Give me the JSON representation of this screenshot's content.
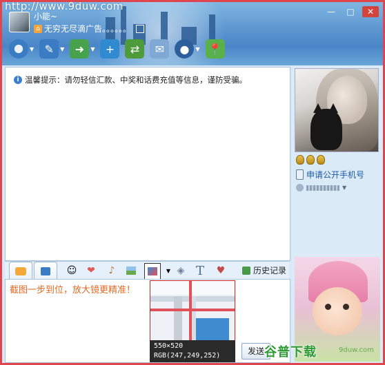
{
  "watermark": "http://www.9duw.com",
  "user": {
    "nickname": "小能~",
    "signature": "无穷无尽滴广告。。。。。。"
  },
  "window_buttons": {
    "minimize": "—",
    "maximize": "□",
    "close": "✕"
  },
  "toolbar": {
    "items": [
      {
        "name": "video-call",
        "icon": "camera-icon",
        "color": "#3a7cc4",
        "has_dropdown": true
      },
      {
        "name": "voice-call",
        "icon": "pen-icon",
        "color": "#3a7cc4",
        "has_dropdown": true
      },
      {
        "name": "file-transfer",
        "icon": "file-send-icon",
        "color": "#47a34b",
        "has_dropdown": true
      },
      {
        "name": "create-group",
        "icon": "group-add-icon",
        "color": "#2f8ad0",
        "has_dropdown": false
      },
      {
        "name": "share-screen",
        "icon": "share-icon",
        "color": "#4d9b3a",
        "has_dropdown": false
      },
      {
        "name": "send-mail",
        "icon": "mail-icon",
        "color": "#7fa8d4",
        "has_dropdown": false
      },
      {
        "name": "apps",
        "icon": "police-hat-icon",
        "color": "#2d5f9c",
        "has_dropdown": true
      },
      {
        "name": "map",
        "icon": "map-pin-icon",
        "color": "#5ab04a",
        "has_dropdown": false
      }
    ]
  },
  "chat": {
    "tip_text": "温馨提示：请勿轻信汇款、中奖和话费充值等信息，谨防受骗。"
  },
  "contact_panel": {
    "phone_label": "申请公开手机号"
  },
  "input_toolbar": {
    "history_label": "历史记录",
    "text_icon_label": "T"
  },
  "input": {
    "text": "截图一步到位，放大镜更精准！",
    "send_label": "发送"
  },
  "magnifier": {
    "size_text": "550×520",
    "rgb_text": "RGB(247,249,252)"
  },
  "brand": {
    "logo_text": "谷普下载",
    "logo_sub": "9duw.com"
  }
}
